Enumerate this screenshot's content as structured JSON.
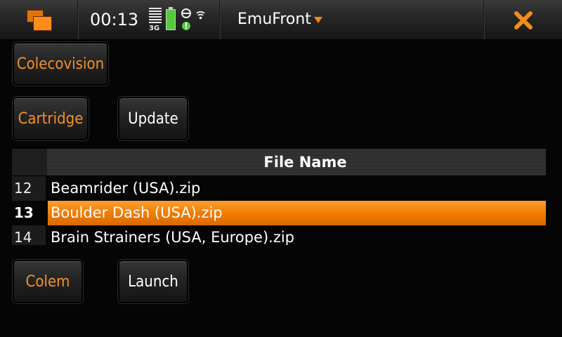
{
  "status_bar": {
    "time": "00:13",
    "network_label": "3G",
    "app_title": "EmuFront",
    "icons": [
      "task-switcher-icon",
      "signal-strength-icon",
      "battery-icon",
      "connection-status-icon",
      "dropdown-arrow-icon",
      "close-icon"
    ],
    "accent_color": "#f08a14"
  },
  "controls": {
    "platform_button": "Colecovision",
    "media_type_button": "Cartridge",
    "update_button": "Update",
    "emulator_button": "Colem",
    "launch_button": "Launch"
  },
  "file_table": {
    "header": "File Name",
    "rows": [
      {
        "number": "12",
        "name": "Beamrider (USA).zip"
      },
      {
        "number": "13",
        "name": "Boulder Dash (USA).zip",
        "selected": true
      },
      {
        "number": "14",
        "name": "Brain Strainers (USA, Europe).zip"
      }
    ],
    "selection_color": "#f07a00"
  }
}
